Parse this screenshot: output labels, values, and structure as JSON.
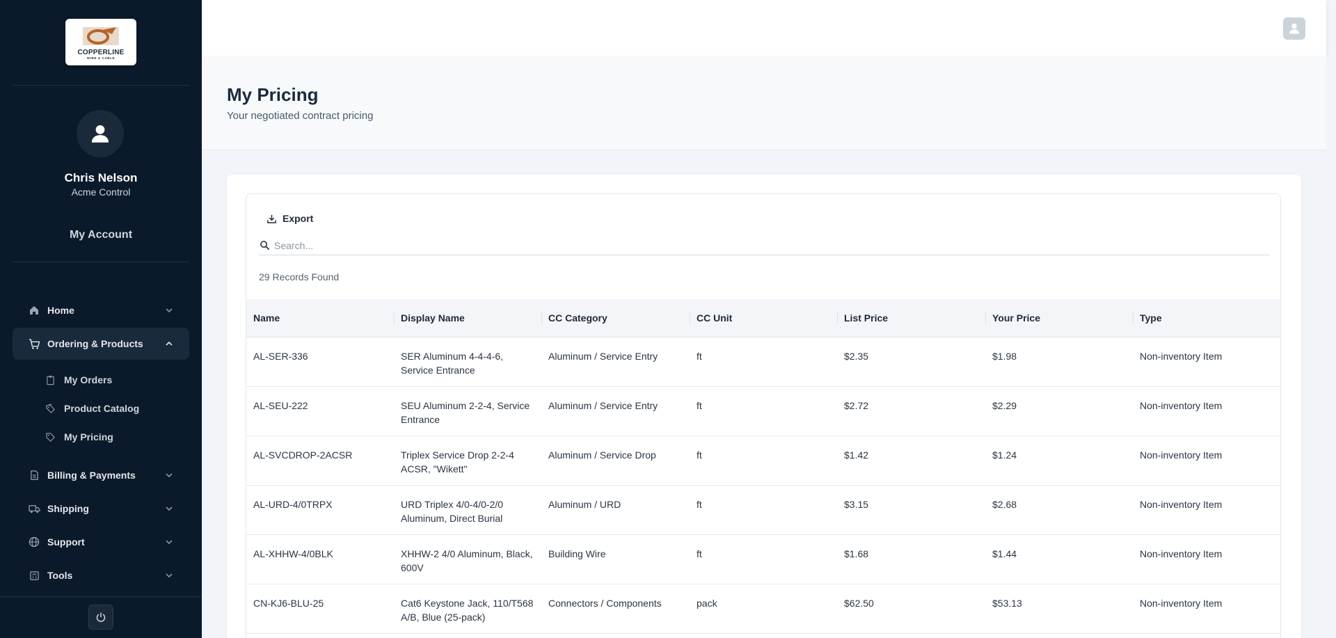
{
  "brand": {
    "logo_text": "COPPERLINE",
    "logo_sub": "WIRE & CABLE"
  },
  "user": {
    "name": "Chris Nelson",
    "company": "Acme Control",
    "account_link": "My Account"
  },
  "nav": {
    "items": [
      {
        "label": "Home",
        "icon": "home-icon"
      },
      {
        "label": "Ordering & Products",
        "icon": "cart-icon"
      },
      {
        "label": "Billing & Payments",
        "icon": "document-icon"
      },
      {
        "label": "Shipping",
        "icon": "truck-icon"
      },
      {
        "label": "Support",
        "icon": "globe-icon"
      },
      {
        "label": "Tools",
        "icon": "calculator-icon"
      }
    ],
    "sub_items": [
      {
        "label": "My Orders",
        "icon": "clipboard-icon"
      },
      {
        "label": "Product Catalog",
        "icon": "tags-icon"
      },
      {
        "label": "My Pricing",
        "icon": "tag-icon"
      }
    ]
  },
  "page": {
    "title": "My Pricing",
    "subtitle": "Your negotiated contract pricing"
  },
  "toolbar": {
    "export_label": "Export",
    "search_placeholder": "Search...",
    "records_found": "29 Records Found"
  },
  "table": {
    "columns": [
      "Name",
      "Display Name",
      "CC Category",
      "CC Unit",
      "List Price",
      "Your Price",
      "Type"
    ],
    "rows": [
      [
        "AL-SER-336",
        "SER Aluminum 4-4-4-6, Service Entrance",
        "Aluminum / Service Entry",
        "ft",
        "$2.35",
        "$1.98",
        "Non-inventory Item"
      ],
      [
        "AL-SEU-222",
        "SEU Aluminum 2-2-4, Service Entrance",
        "Aluminum / Service Entry",
        "ft",
        "$2.72",
        "$2.29",
        "Non-inventory Item"
      ],
      [
        "AL-SVCDROP-2ACSR",
        "Triplex Service Drop 2-2-4 ACSR, \"Wikett\"",
        "Aluminum / Service Drop",
        "ft",
        "$1.42",
        "$1.24",
        "Non-inventory Item"
      ],
      [
        "AL-URD-4/0TRPX",
        "URD Triplex 4/0-4/0-2/0 Aluminum, Direct Burial",
        "Aluminum / URD",
        "ft",
        "$3.15",
        "$2.68",
        "Non-inventory Item"
      ],
      [
        "AL-XHHW-4/0BLK",
        "XHHW-2 4/0 Aluminum, Black, 600V",
        "Building Wire",
        "ft",
        "$1.68",
        "$1.44",
        "Non-inventory Item"
      ],
      [
        "CN-KJ6-BLU-25",
        "Cat6 Keystone Jack, 110/T568 A/B, Blue (25-pack)",
        "Connectors / Components",
        "pack",
        "$62.50",
        "$53.13",
        "Non-inventory Item"
      ]
    ]
  }
}
